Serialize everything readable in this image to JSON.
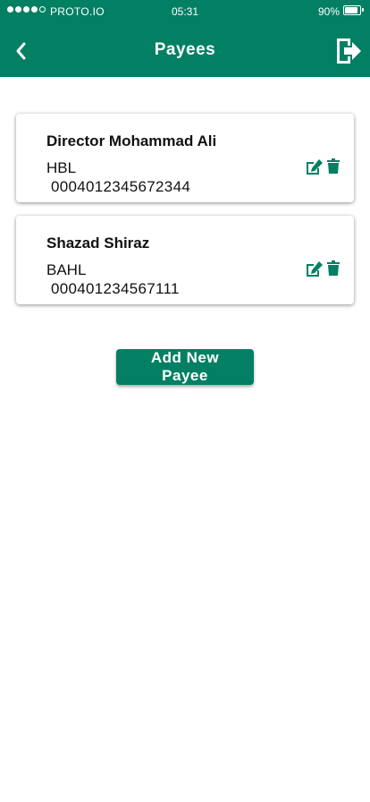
{
  "status_bar": {
    "carrier": "PROTO.IO",
    "time": "05:31",
    "battery": "90%",
    "battery_level": 0.9,
    "signal_bars_filled": 4,
    "signal_bars_total": 5
  },
  "header": {
    "title": "Payees",
    "back_icon": "chevron-left-icon",
    "logout_icon": "logout-icon"
  },
  "payees": [
    {
      "name": "Director Mohammad Ali",
      "bank": "HBL",
      "account": "0004012345672344"
    },
    {
      "name": "Shazad Shiraz",
      "bank": "BAHL",
      "account": "000401234567111"
    }
  ],
  "actions": {
    "add_label": "Add New Payee",
    "edit_icon": "edit-icon",
    "delete_icon": "trash-icon"
  },
  "colors": {
    "brand": "#038064",
    "text": "#111111",
    "background": "#ffffff"
  }
}
